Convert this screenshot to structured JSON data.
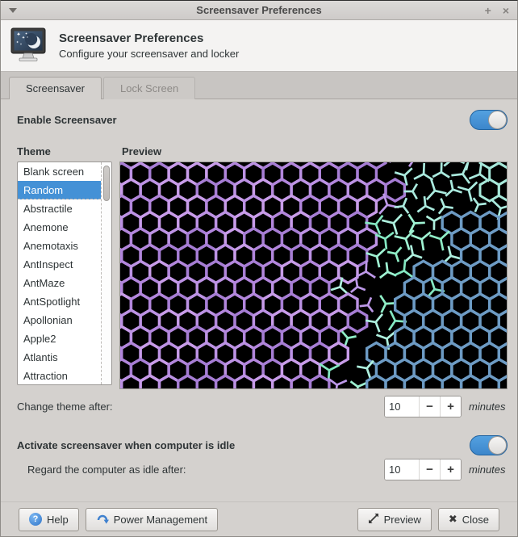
{
  "window": {
    "title": "Screensaver Preferences",
    "menu_glyph": "",
    "maximize_glyph": "+",
    "close_glyph": "×"
  },
  "header": {
    "title": "Screensaver Preferences",
    "subtitle": "Configure your screensaver and locker"
  },
  "tabs": {
    "screensaver": "Screensaver",
    "lock_screen": "Lock Screen"
  },
  "screensaver_tab": {
    "enable_label": "Enable Screensaver",
    "enable_on": true,
    "theme_label": "Theme",
    "preview_label": "Preview",
    "themes": [
      "Blank screen",
      "Random",
      "Abstractile",
      "Anemone",
      "Anemotaxis",
      "AntInspect",
      "AntMaze",
      "AntSpotlight",
      "Apollonian",
      "Apple2",
      "Atlantis",
      "Attraction"
    ],
    "selected_theme": "Random",
    "change_theme_label": "Change theme after:",
    "change_theme_value": "10",
    "minutes_label": "minutes",
    "idle_section_label": "Activate screensaver when computer is idle",
    "idle_on": true,
    "idle_delay_label": "Regard the computer as idle after:",
    "idle_delay_value": "10"
  },
  "spin": {
    "minus": "−",
    "plus": "+"
  },
  "footer": {
    "help": "Help",
    "help_icon_glyph": "?",
    "power_management": "Power Management",
    "preview": "Preview",
    "close": "Close",
    "close_icon_glyph": "✖"
  },
  "colors": {
    "accent": "#4491d6",
    "switch_on": "#3c86cb"
  },
  "preview": {
    "bg": "#000000",
    "purple_hex_colors": [
      "#b286dc",
      "#bc92e4",
      "#a67dd4",
      "#c89ce9"
    ],
    "mint_tripod_colors": [
      "#8feec6",
      "#9ff2d2",
      "#aef0de",
      "#84e8c2"
    ],
    "purple_tripod_color": "#bd98e8",
    "cyan_tripod_color": "#aaeade",
    "blue_hex_color": "#6d9bc4",
    "cyan_hex_color": "#a6e8da"
  }
}
